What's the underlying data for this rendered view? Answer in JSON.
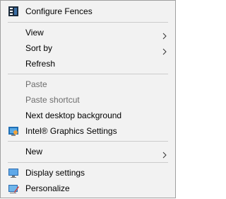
{
  "menu": {
    "items": [
      {
        "label": "Configure Fences",
        "icon": "fences-icon"
      },
      {
        "label": "View",
        "submenu": true
      },
      {
        "label": "Sort by",
        "submenu": true
      },
      {
        "label": "Refresh"
      },
      {
        "label": "Paste",
        "disabled": true
      },
      {
        "label": "Paste shortcut",
        "disabled": true
      },
      {
        "label": "Next desktop background"
      },
      {
        "label": "Intel® Graphics Settings",
        "icon": "intel-graphics-icon"
      },
      {
        "label": "New",
        "submenu": true
      },
      {
        "label": "Display settings",
        "icon": "display-icon"
      },
      {
        "label": "Personalize",
        "icon": "personalize-icon"
      }
    ]
  },
  "colors": {
    "menu_background": "#f2f2f2",
    "border": "#a0a0a0",
    "separator": "#cccccc",
    "disabled_text": "#6d6d6d"
  }
}
